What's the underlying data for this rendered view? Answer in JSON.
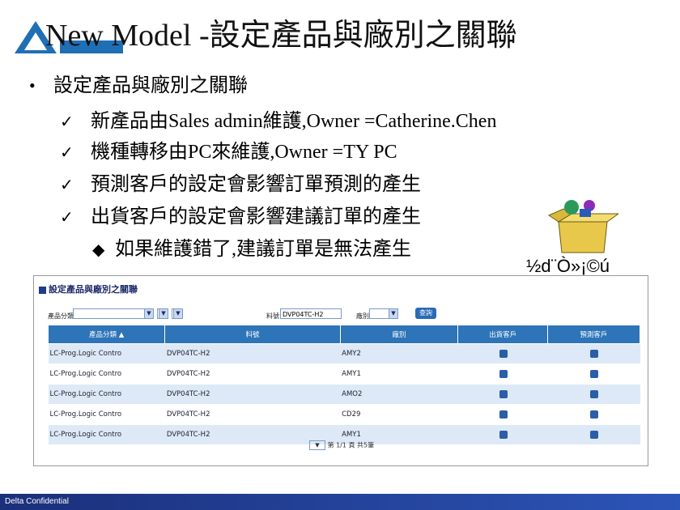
{
  "slide": {
    "title": "New Model -設定產品與廠別之關聯",
    "bullet": "設定產品與廠別之關聯",
    "checks": [
      "新產品由Sales admin維護,Owner =Catherine.Chen",
      "機種轉移由PC來維護,Owner =TY PC",
      "預測客戶的設定會影響訂單預測的產生",
      "出貨客戶的設定會影響建議訂單的產生"
    ],
    "sub_bullet": "如果維護錯了,建議訂單是無法產生",
    "check_glyph": "✓",
    "bullet_glyph": "•",
    "diamond_glyph": "◆",
    "embedded_object_label": "½d¨Ò»¡©ú",
    "footer": "Delta Confidential"
  },
  "app": {
    "title": "設定產品與廠別之關聯",
    "filters": {
      "product_class_label": "產品分類",
      "model_label": "料號",
      "model_value": "DVP04TC-H2",
      "plant_label": "廠別",
      "query_button": "查詢"
    },
    "grid": {
      "headers": [
        "產品分類",
        "料號",
        "廠別",
        "出貨客戶",
        "預測客戶"
      ],
      "rows": [
        [
          "LC-Prog.Logic Contro",
          "DVP04TC-H2",
          "AMY2"
        ],
        [
          "LC-Prog.Logic Contro",
          "DVP04TC-H2",
          "AMY1"
        ],
        [
          "LC-Prog.Logic Contro",
          "DVP04TC-H2",
          "AMO2"
        ],
        [
          "LC-Prog.Logic Contro",
          "DVP04TC-H2",
          "CD29"
        ],
        [
          "LC-Prog.Logic Contro",
          "DVP04TC-H2",
          "AMY1"
        ]
      ]
    },
    "pager": "第 1/1 頁 共5筆"
  },
  "colors": {
    "header_blue": "#2d74b8",
    "row_alt": "#dde9f6",
    "footer": "#1b2f7a"
  }
}
